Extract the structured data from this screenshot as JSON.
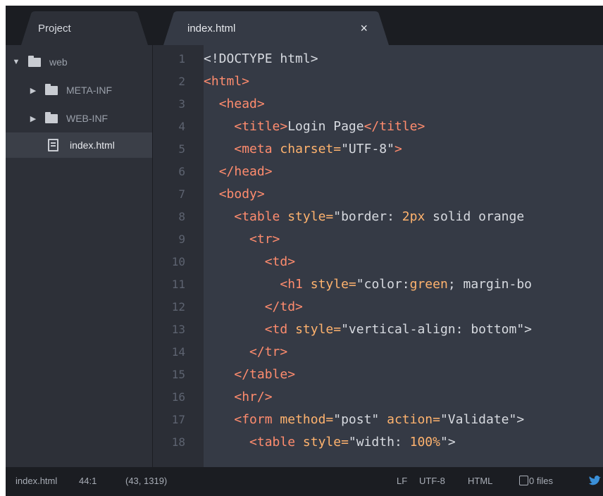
{
  "tabs": {
    "project_label": "Project",
    "file_label": "index.html",
    "close_glyph": "×"
  },
  "tree": {
    "root": "web",
    "folders": [
      "META-INF",
      "WEB-INF"
    ],
    "file": "index.html"
  },
  "editor": {
    "line_numbers": [
      "1",
      "2",
      "3",
      "4",
      "5",
      "6",
      "7",
      "8",
      "9",
      "10",
      "11",
      "12",
      "13",
      "14",
      "15",
      "16",
      "17",
      "18"
    ]
  },
  "code_lines": [
    [
      [
        "p",
        "<!DOCTYPE html>"
      ]
    ],
    [
      [
        "t",
        "<html>"
      ]
    ],
    [
      [
        "p",
        "  "
      ],
      [
        "t",
        "<head>"
      ]
    ],
    [
      [
        "p",
        "    "
      ],
      [
        "t",
        "<title>"
      ],
      [
        "s",
        "Login Page"
      ],
      [
        "t",
        "</title>"
      ]
    ],
    [
      [
        "p",
        "    "
      ],
      [
        "t",
        "<meta "
      ],
      [
        "a",
        "charset="
      ],
      [
        "s",
        "\"UTF-8\""
      ],
      [
        "t",
        ">"
      ]
    ],
    [
      [
        "p",
        "  "
      ],
      [
        "t",
        "</head>"
      ]
    ],
    [
      [
        "p",
        "  "
      ],
      [
        "t",
        "<body>"
      ]
    ],
    [
      [
        "p",
        "    "
      ],
      [
        "t",
        "<table "
      ],
      [
        "a",
        "style="
      ],
      [
        "s",
        "\"border: "
      ],
      [
        "v",
        "2px"
      ],
      [
        "s",
        " solid orange"
      ]
    ],
    [
      [
        "p",
        "      "
      ],
      [
        "t",
        "<tr>"
      ]
    ],
    [
      [
        "p",
        "        "
      ],
      [
        "t",
        "<td>"
      ]
    ],
    [
      [
        "p",
        "          "
      ],
      [
        "t",
        "<h1 "
      ],
      [
        "a",
        "style="
      ],
      [
        "s",
        "\"color:"
      ],
      [
        "v",
        "green"
      ],
      [
        "s",
        "; margin-bo"
      ]
    ],
    [
      [
        "p",
        "        "
      ],
      [
        "t",
        "</td>"
      ]
    ],
    [
      [
        "p",
        "        "
      ],
      [
        "t",
        "<td "
      ],
      [
        "a",
        "style="
      ],
      [
        "s",
        "\"vertical-align: bottom\">"
      ]
    ],
    [
      [
        "p",
        "      "
      ],
      [
        "t",
        "</tr>"
      ]
    ],
    [
      [
        "p",
        "    "
      ],
      [
        "t",
        "</table>"
      ]
    ],
    [
      [
        "p",
        "    "
      ],
      [
        "t",
        "<hr/>"
      ]
    ],
    [
      [
        "p",
        "    "
      ],
      [
        "t",
        "<form "
      ],
      [
        "a",
        "method="
      ],
      [
        "s",
        "\"post\" "
      ],
      [
        "a",
        "action="
      ],
      [
        "s",
        "\"Validate\">"
      ]
    ],
    [
      [
        "p",
        "      "
      ],
      [
        "t",
        "<table "
      ],
      [
        "a",
        "style="
      ],
      [
        "s",
        "\"width: "
      ],
      [
        "v",
        "100%"
      ],
      [
        "s",
        "\">"
      ]
    ]
  ],
  "status": {
    "file": "index.html",
    "cursor": "44:1",
    "selection": "(43, 1319)",
    "line_ending": "LF",
    "encoding": "UTF-8",
    "grammar": "HTML",
    "files": "0 files"
  },
  "colors": {
    "tag": "#ff8c6e",
    "attribute": "#ffb36e",
    "text": "#d7dae0",
    "status_bird": "#3a8fd8"
  }
}
